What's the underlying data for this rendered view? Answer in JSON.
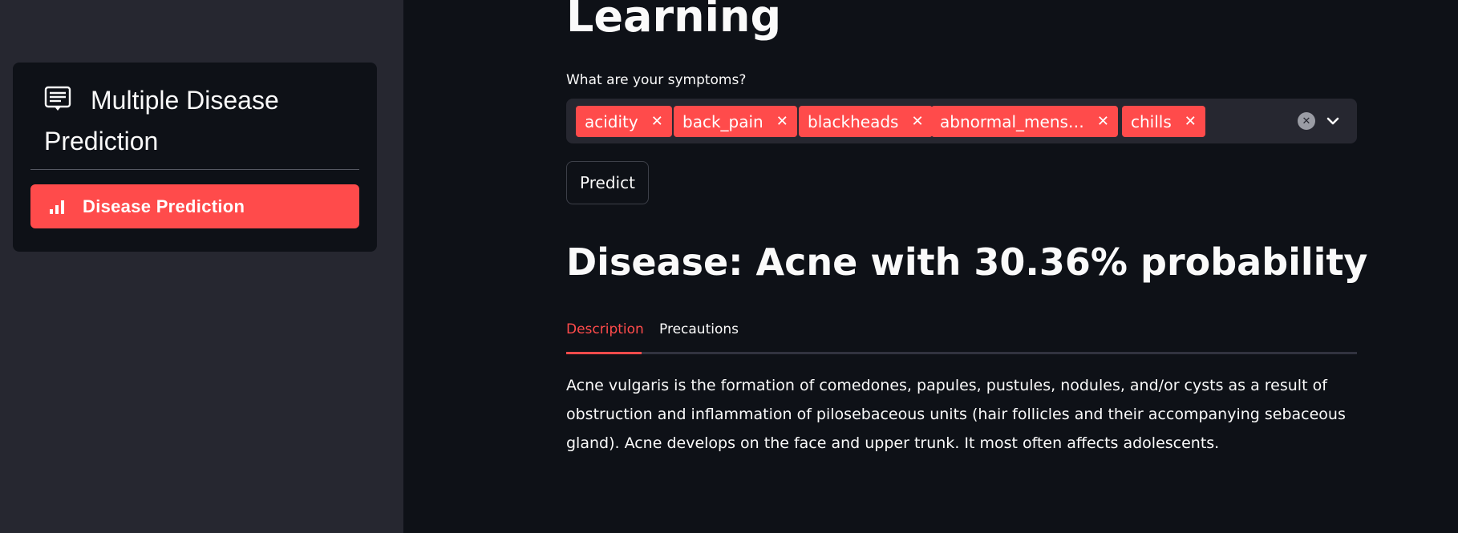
{
  "sidebar": {
    "menu_title": "Multiple Disease Prediction",
    "menu_title_icon": "card-text-icon",
    "items": [
      {
        "label": "Disease Prediction",
        "icon": "bar-chart-icon",
        "active": true
      }
    ]
  },
  "main": {
    "title": "Learning",
    "symptoms_label": "What are your symptoms?",
    "selected_symptoms": [
      "acidity",
      "back_pain",
      "blackheads",
      "abnormal_mens…",
      "chills"
    ],
    "predict_label": "Predict",
    "result_text": "Disease: Acne with 30.36% probability",
    "tabs": [
      {
        "label": "Description",
        "active": true
      },
      {
        "label": "Precautions",
        "active": false
      }
    ],
    "description": "Acne vulgaris is the formation of comedones, papules, pustules, nodules, and/or cysts as a result of obstruction and inflammation of pilosebaceous units (hair follicles and their accompanying sebaceous gland). Acne develops on the face and upper trunk. It most often affects adolescents."
  },
  "colors": {
    "accent": "#ff4b4b",
    "background": "#0e1117",
    "sidebar_background": "#262730"
  }
}
